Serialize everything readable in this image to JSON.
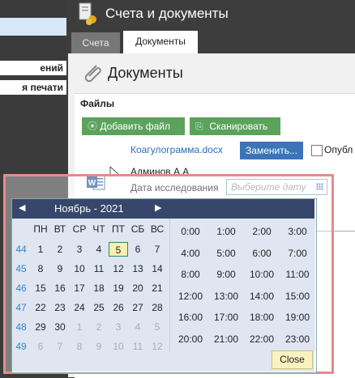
{
  "left_menu": {
    "item1": "ений",
    "item2": "я печати"
  },
  "header": {
    "title": "Счета и документы"
  },
  "tabs": [
    {
      "label": "Счета",
      "active": false
    },
    {
      "label": "Документы",
      "active": true
    }
  ],
  "documents": {
    "title": "Документы",
    "files_label": "Файлы",
    "add_file_button": "Добавить файл",
    "scan_button": "Сканировать",
    "file_name": "Коагулограмма.docx",
    "replace_button": "Заменить...",
    "publish_label": "Опубл",
    "author": "Админов А.А.",
    "date_label": "Дата исследования",
    "date_placeholder": "Выберите дату"
  },
  "datepicker": {
    "month": "Ноябрь - 2021",
    "weekdays": [
      "ПН",
      "ВТ",
      "СР",
      "ЧТ",
      "ПТ",
      "СБ",
      "ВС"
    ],
    "weeks": [
      "44",
      "45",
      "46",
      "47",
      "48",
      "49"
    ],
    "days": [
      [
        "1",
        "2",
        "3",
        "4",
        "5",
        "6",
        "7"
      ],
      [
        "8",
        "9",
        "10",
        "11",
        "12",
        "13",
        "14"
      ],
      [
        "15",
        "16",
        "17",
        "18",
        "19",
        "20",
        "21"
      ],
      [
        "22",
        "23",
        "24",
        "25",
        "26",
        "27",
        "28"
      ],
      [
        "29",
        "30",
        "1",
        "2",
        "3",
        "4",
        "5"
      ],
      [
        "6",
        "7",
        "8",
        "9",
        "10",
        "11",
        "12"
      ]
    ],
    "today": "5",
    "times": [
      "0:00",
      "1:00",
      "2:00",
      "3:00",
      "4:00",
      "5:00",
      "6:00",
      "7:00",
      "8:00",
      "9:00",
      "10:00",
      "11:00",
      "12:00",
      "13:00",
      "14:00",
      "15:00",
      "16:00",
      "17:00",
      "18:00",
      "19:00",
      "20:00",
      "21:00",
      "22:00",
      "23:00"
    ],
    "close_button": "Close"
  },
  "colors": {
    "header_bg": "#36476b",
    "green_button": "#5ba35b",
    "blue_button": "#3c74b8",
    "today_highlight": "#f7f0b2",
    "overlay_border": "#e88a8a"
  }
}
